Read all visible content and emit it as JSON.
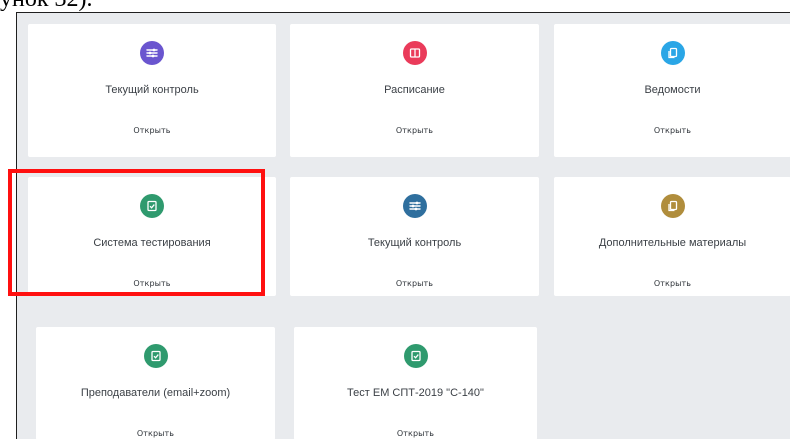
{
  "caption": "унок 32).",
  "cards": [
    {
      "title": "Текущий контроль",
      "open_label": "Открыть",
      "icon": "sliders-icon",
      "color": "#6a55cf"
    },
    {
      "title": "Расписание",
      "open_label": "Открыть",
      "icon": "book-icon",
      "color": "#ea3b5a"
    },
    {
      "title": "Ведомости",
      "open_label": "Открыть",
      "icon": "copy-icon",
      "color": "#2aa6e6"
    },
    {
      "title": "Система тестирования",
      "open_label": "Открыть",
      "icon": "test-icon",
      "color": "#2f9a6e"
    },
    {
      "title": "Текущий контроль",
      "open_label": "Открыть",
      "icon": "sliders-icon",
      "color": "#2f6f9e"
    },
    {
      "title": "Дополнительные материалы",
      "open_label": "Открыть",
      "icon": "copy-icon",
      "color": "#b08d3c"
    },
    {
      "title": "Преподаватели (email+zoom)",
      "open_label": "Открыть",
      "icon": "test-icon",
      "color": "#2f9a6e"
    },
    {
      "title": "Тест ЕМ СПТ-2019 \"С-140\"",
      "open_label": "Открыть",
      "icon": "test-icon",
      "color": "#2f9a6e"
    }
  ],
  "highlight_color": "#ff1010"
}
